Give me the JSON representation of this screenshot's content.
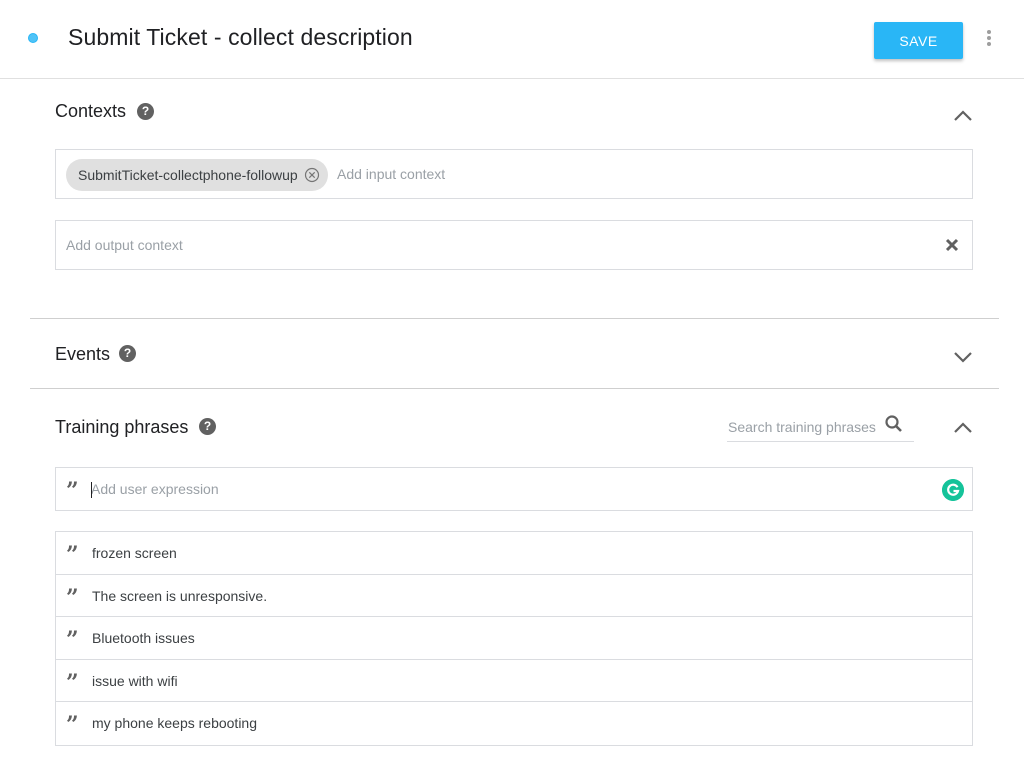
{
  "header": {
    "title": "Submit Ticket - collect description",
    "save_label": "SAVE"
  },
  "contexts": {
    "title": "Contexts",
    "input_chips": [
      "SubmitTicket-collectphone-followup"
    ],
    "input_placeholder": "Add input context",
    "output_placeholder": "Add output context"
  },
  "events": {
    "title": "Events"
  },
  "training": {
    "title": "Training phrases",
    "search_placeholder": "Search training phrases",
    "expression_placeholder": "Add user expression",
    "phrases": [
      "frozen screen",
      "The screen is unresponsive.",
      "Bluetooth issues",
      "issue with wifi",
      "my phone keeps rebooting"
    ]
  },
  "colors": {
    "accent": "#29b6f6",
    "grammarly": "#15c39a",
    "icon_gray": "#616161"
  },
  "icons": {
    "help": "help-circle-icon",
    "collapse": "chevron-up-icon",
    "expand": "chevron-down-icon",
    "clear": "close-x-icon",
    "search": "search-icon",
    "quote": "quote-icon",
    "more": "more-vert-icon",
    "extension": "grammarly-icon"
  }
}
